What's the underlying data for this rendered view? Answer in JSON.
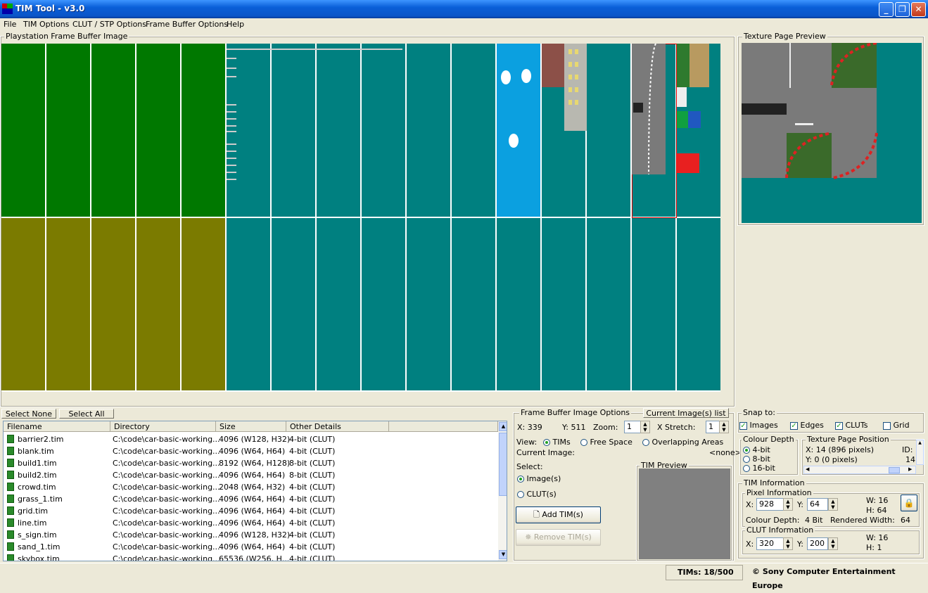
{
  "window": {
    "title": "TIM Tool - v3.0",
    "minimize": "_",
    "restore": "❐",
    "close": "✕"
  },
  "menu": [
    "File",
    "TIM Options",
    "CLUT / STP Options",
    "Frame Buffer Options",
    "Help"
  ],
  "framebuffer": {
    "label": "Playstation Frame Buffer Image",
    "green": "#007800",
    "olive": "#7b7b00",
    "teal": "#008080",
    "sky": "#0ba0e0"
  },
  "preview": {
    "label": "Texture Page Preview"
  },
  "select_none": "Select None",
  "select_all": "Select All",
  "list": {
    "headers": [
      "Filename",
      "Directory",
      "Size",
      "Other Details"
    ],
    "rows": [
      [
        "barrier2.tim",
        "C:\\code\\car-basic-working...",
        "4096 (W128, H32)",
        "4-bit (CLUT)"
      ],
      [
        "blank.tim",
        "C:\\code\\car-basic-working...",
        "4096 (W64, H64)",
        "4-bit (CLUT)"
      ],
      [
        "build1.tim",
        "C:\\code\\car-basic-working...",
        "8192 (W64, H128)",
        "8-bit (CLUT)"
      ],
      [
        "build2.tim",
        "C:\\code\\car-basic-working...",
        "4096 (W64, H64)",
        "8-bit (CLUT)"
      ],
      [
        "crowd.tim",
        "C:\\code\\car-basic-working...",
        "2048 (W64, H32)",
        "4-bit (CLUT)"
      ],
      [
        "grass_1.tim",
        "C:\\code\\car-basic-working...",
        "4096 (W64, H64)",
        "4-bit (CLUT)"
      ],
      [
        "grid.tim",
        "C:\\code\\car-basic-working...",
        "4096 (W64, H64)",
        "4-bit (CLUT)"
      ],
      [
        "line.tim",
        "C:\\code\\car-basic-working...",
        "4096 (W64, H64)",
        "4-bit (CLUT)"
      ],
      [
        "s_sign.tim",
        "C:\\code\\car-basic-working...",
        "4096 (W128, H32)",
        "4-bit (CLUT)"
      ],
      [
        "sand_1.tim",
        "C:\\code\\car-basic-working...",
        "4096 (W64, H64)",
        "4-bit (CLUT)"
      ],
      [
        "skybox.tim",
        "C:\\code\\car-basic-working...",
        "65536 (W256, H...",
        "4-bit (CLUT)"
      ]
    ]
  },
  "fbopts": {
    "label": "Frame Buffer Image Options",
    "current_list": "Current Image(s) list",
    "x": "X:  339",
    "y": "Y: 511",
    "zoom_lbl": "Zoom:",
    "zoom": "1",
    "xstretch_lbl": "X Stretch:",
    "xstretch": "1",
    "view": "View:",
    "tims": "TIMs",
    "free": "Free Space",
    "overlap": "Overlapping Areas",
    "cur_img": "Current Image:",
    "none": "<none>"
  },
  "select": {
    "label": "Select:",
    "images": "Image(s)",
    "cluts": "CLUT(s)"
  },
  "add_tim": "Add TIM(s)",
  "remove_tim": "Remove TIM(s)",
  "tim_preview": "TIM Preview",
  "snap": {
    "label": "Snap to:",
    "images": "Images",
    "edges": "Edges",
    "cluts": "CLUTs",
    "grid": "Grid"
  },
  "depth": {
    "label": "Colour Depth",
    "b4": "4-bit",
    "b8": "8-bit",
    "b16": "16-bit"
  },
  "texpos": {
    "label": "Texture Page Position",
    "x": "X: 14 (896 pixels)",
    "y": "Y: 0 (0 pixels)",
    "id": "ID:",
    "id_val": "14"
  },
  "timinfo": {
    "label": "TIM Information",
    "pixel": "Pixel Information",
    "x_lbl": "X:",
    "x": "928",
    "y_lbl": "Y:",
    "y": "64",
    "w": "W: 16",
    "h": "H: 64",
    "depth": "Colour Depth:",
    "depth_val": "4 Bit",
    "rw": "Rendered Width:",
    "rw_val": "64",
    "clut": "CLUT Information",
    "cx": "320",
    "cy": "200",
    "cw": "W: 16",
    "ch": "H: 1"
  },
  "status": {
    "tims": "TIMs: 18/500",
    "copy": "© Sony Computer Entertainment Europe"
  }
}
